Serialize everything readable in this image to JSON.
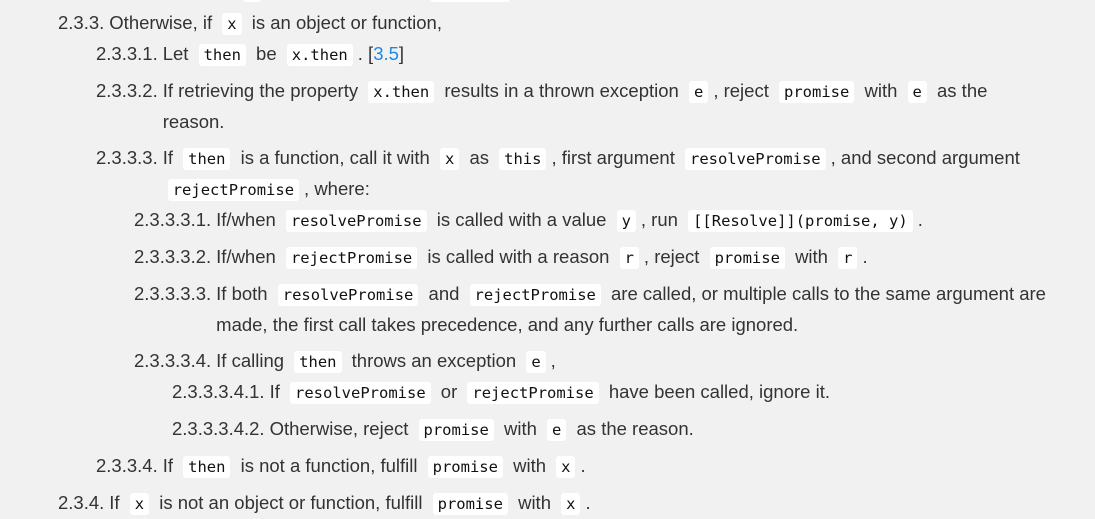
{
  "items": [
    {
      "num": "2.3.3.",
      "segs": [
        {
          "t": "Otherwise, if"
        },
        {
          "c": "x"
        },
        {
          "t": "is an object or function,"
        }
      ],
      "children": [
        {
          "num": "2.3.3.1.",
          "segs": [
            {
              "t": "Let"
            },
            {
              "c": "then"
            },
            {
              "t": "be"
            },
            {
              "c": "x.then"
            },
            {
              "t": ". ["
            },
            {
              "a": "3.5"
            },
            {
              "t": "]"
            }
          ]
        },
        {
          "num": "2.3.3.2.",
          "segs": [
            {
              "t": "If retrieving the property"
            },
            {
              "c": "x.then"
            },
            {
              "t": "results in a thrown exception"
            },
            {
              "c": "e"
            },
            {
              "t": ", reject"
            },
            {
              "c": "promise"
            },
            {
              "t": "with"
            },
            {
              "c": "e"
            },
            {
              "t": "as the reason."
            }
          ]
        },
        {
          "num": "2.3.3.3.",
          "segs": [
            {
              "t": "If"
            },
            {
              "c": "then"
            },
            {
              "t": "is a function, call it with"
            },
            {
              "c": "x"
            },
            {
              "t": "as"
            },
            {
              "c": "this"
            },
            {
              "t": ", first argument"
            },
            {
              "c": "resolvePromise"
            },
            {
              "t": ", and second argument"
            },
            {
              "c": "rejectPromise"
            },
            {
              "t": ", where:"
            }
          ],
          "children": [
            {
              "num": "2.3.3.3.1.",
              "segs": [
                {
                  "t": "If/when"
                },
                {
                  "c": "resolvePromise"
                },
                {
                  "t": "is called with a value"
                },
                {
                  "c": "y"
                },
                {
                  "t": ", run"
                },
                {
                  "c": "[[Resolve]](promise, y)"
                },
                {
                  "t": "."
                }
              ]
            },
            {
              "num": "2.3.3.3.2.",
              "segs": [
                {
                  "t": "If/when"
                },
                {
                  "c": "rejectPromise"
                },
                {
                  "t": "is called with a reason"
                },
                {
                  "c": "r"
                },
                {
                  "t": ", reject"
                },
                {
                  "c": "promise"
                },
                {
                  "t": "with"
                },
                {
                  "c": "r"
                },
                {
                  "t": "."
                }
              ]
            },
            {
              "num": "2.3.3.3.3.",
              "segs": [
                {
                  "t": "If both"
                },
                {
                  "c": "resolvePromise"
                },
                {
                  "t": "and"
                },
                {
                  "c": "rejectPromise"
                },
                {
                  "t": "are called, or multiple calls to the same argument are made, the first call takes precedence, and any further calls are ignored."
                }
              ]
            },
            {
              "num": "2.3.3.3.4.",
              "segs": [
                {
                  "t": "If calling"
                },
                {
                  "c": "then"
                },
                {
                  "t": "throws an exception"
                },
                {
                  "c": "e"
                },
                {
                  "t": ","
                }
              ],
              "children": [
                {
                  "num": "2.3.3.3.4.1.",
                  "segs": [
                    {
                      "t": "If"
                    },
                    {
                      "c": "resolvePromise"
                    },
                    {
                      "t": "or"
                    },
                    {
                      "c": "rejectPromise"
                    },
                    {
                      "t": "have been called, ignore it."
                    }
                  ]
                },
                {
                  "num": "2.3.3.3.4.2.",
                  "segs": [
                    {
                      "t": "Otherwise, reject"
                    },
                    {
                      "c": "promise"
                    },
                    {
                      "t": "with"
                    },
                    {
                      "c": "e"
                    },
                    {
                      "t": "as the reason."
                    }
                  ]
                }
              ]
            }
          ]
        },
        {
          "num": "2.3.3.4.",
          "segs": [
            {
              "t": "If"
            },
            {
              "c": "then"
            },
            {
              "t": "is not a function, fulfill"
            },
            {
              "c": "promise"
            },
            {
              "t": "with"
            },
            {
              "c": "x"
            },
            {
              "t": "."
            }
          ]
        }
      ]
    },
    {
      "num": "2.3.4.",
      "segs": [
        {
          "t": "If"
        },
        {
          "c": "x"
        },
        {
          "t": "is not an object or function, fulfill"
        },
        {
          "c": "promise"
        },
        {
          "t": "with"
        },
        {
          "c": "x"
        },
        {
          "t": "."
        }
      ]
    }
  ],
  "colors": {
    "background": "#f1f1f1",
    "text": "#333333",
    "link": "#1e88e5",
    "code_bg": "#ffffff"
  }
}
